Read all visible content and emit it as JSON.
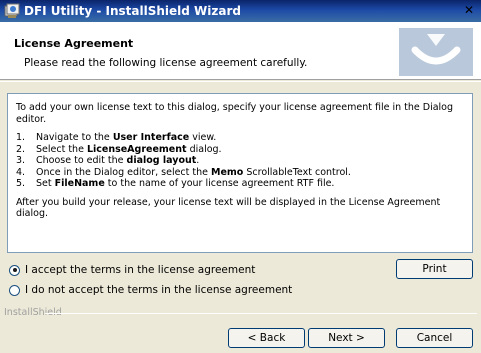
{
  "window": {
    "title": "DFI Utility - InstallShield Wizard",
    "close_glyph": "✕"
  },
  "header": {
    "title": "License Agreement",
    "subtitle": "Please read the following license agreement carefully."
  },
  "license": {
    "intro": "To add your own license text to this dialog, specify your license agreement file in the Dialog editor.",
    "steps": [
      {
        "num": "1.",
        "pre": "Navigate to the ",
        "bold": "User Interface",
        "post": " view."
      },
      {
        "num": "2.",
        "pre": "Select the ",
        "bold": "LicenseAgreement",
        "post": " dialog."
      },
      {
        "num": "3.",
        "pre": "Choose to edit the ",
        "bold": "dialog layout",
        "post": "."
      },
      {
        "num": "4.",
        "pre": "Once in the Dialog editor, select the ",
        "bold": "Memo",
        "post": " ScrollableText control."
      },
      {
        "num": "5.",
        "pre": "Set ",
        "bold": "FileName",
        "post": " to the name of your license agreement RTF file."
      }
    ],
    "outro": "After you build your release, your license text will be displayed in the License Agreement dialog."
  },
  "options": {
    "accept_label": "I accept the terms in the license agreement",
    "decline_label": "I do not accept the terms in the license agreement",
    "selected": "accept"
  },
  "buttons": {
    "print": "Print",
    "back": "< Back",
    "next": "Next >",
    "cancel": "Cancel"
  },
  "footer": {
    "brand": "InstallShield"
  }
}
